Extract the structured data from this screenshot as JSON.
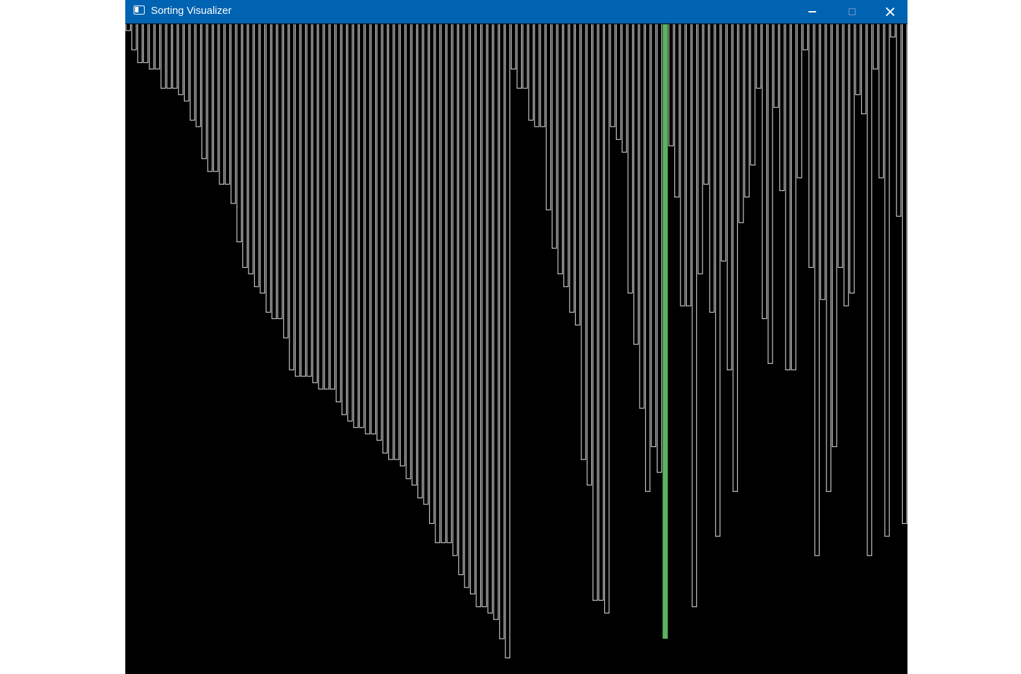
{
  "window": {
    "title": "Sorting Visualizer",
    "icons": {
      "app": "app-window-icon",
      "minimize": "minimize-icon",
      "maximize": "maximize-icon",
      "close": "close-icon"
    }
  },
  "visualizer": {
    "background_color": "#000000",
    "bar_outline_color": "#c8c8c8",
    "highlight_color": "#5ab55e",
    "highlight_index": 92,
    "max_value": 100,
    "values": [
      1,
      4,
      6,
      6,
      7,
      7,
      10,
      10,
      10,
      11,
      12,
      15,
      16,
      21,
      23,
      23,
      25,
      25,
      28,
      34,
      38,
      39,
      41,
      42,
      45,
      46,
      46,
      49,
      54,
      55,
      55,
      55,
      56,
      57,
      57,
      57,
      59,
      61,
      62,
      63,
      63,
      64,
      64,
      65,
      67,
      68,
      68,
      69,
      71,
      72,
      74,
      75,
      78,
      81,
      81,
      81,
      83,
      86,
      88,
      89,
      91,
      91,
      92,
      93,
      96,
      99,
      7,
      10,
      10,
      15,
      16,
      16,
      29,
      35,
      39,
      41,
      45,
      47,
      68,
      72,
      90,
      90,
      92,
      16,
      18,
      20,
      42,
      50,
      60,
      73,
      66,
      70,
      96,
      19,
      27,
      44,
      44,
      91,
      39,
      25,
      45,
      80,
      37,
      54,
      73,
      31,
      27,
      22,
      10,
      46,
      53,
      13,
      26,
      54,
      54,
      24,
      4,
      38,
      83,
      43,
      73,
      66,
      38,
      44,
      42,
      11,
      14,
      83,
      7,
      24,
      80,
      2,
      30,
      78
    ],
    "bar_values_note": ""
  }
}
